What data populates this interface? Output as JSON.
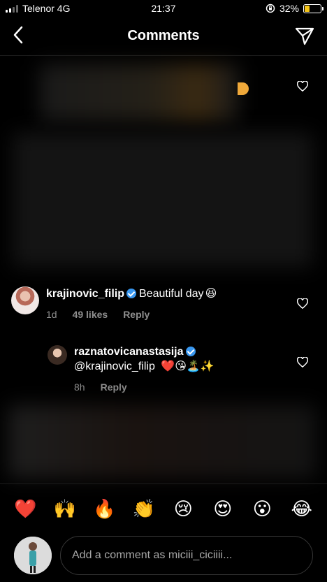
{
  "status_bar": {
    "carrier": "Telenor 4G",
    "time": "21:37",
    "battery_percent": "32%",
    "battery_level": 0.32
  },
  "header": {
    "title": "Comments",
    "back_icon": "chevron-left-icon",
    "send_icon": "paper-plane-icon"
  },
  "comments": [
    {
      "username": "krajinovic_filip",
      "verified": true,
      "text": "Beautiful day",
      "emoji": "😆",
      "time": "1d",
      "likes": "49 likes",
      "reply": "Reply"
    },
    {
      "username": "raznatovicanastasija",
      "verified": true,
      "mention": "@krajinovic_filip",
      "emoji": "❤️😘🏝️✨",
      "time": "8h",
      "reply": "Reply"
    }
  ],
  "emoji_bar": [
    "❤️",
    "🙌",
    "🔥",
    "👏",
    "😢",
    "😍",
    "😮",
    "😂"
  ],
  "comment_input": {
    "placeholder": "Add a comment as miciii_ciciiii..."
  },
  "colors": {
    "background": "#000000",
    "secondary_text": "#8e8e8e",
    "verified_badge": "#3897f0",
    "battery_fill": "#f5c518"
  }
}
